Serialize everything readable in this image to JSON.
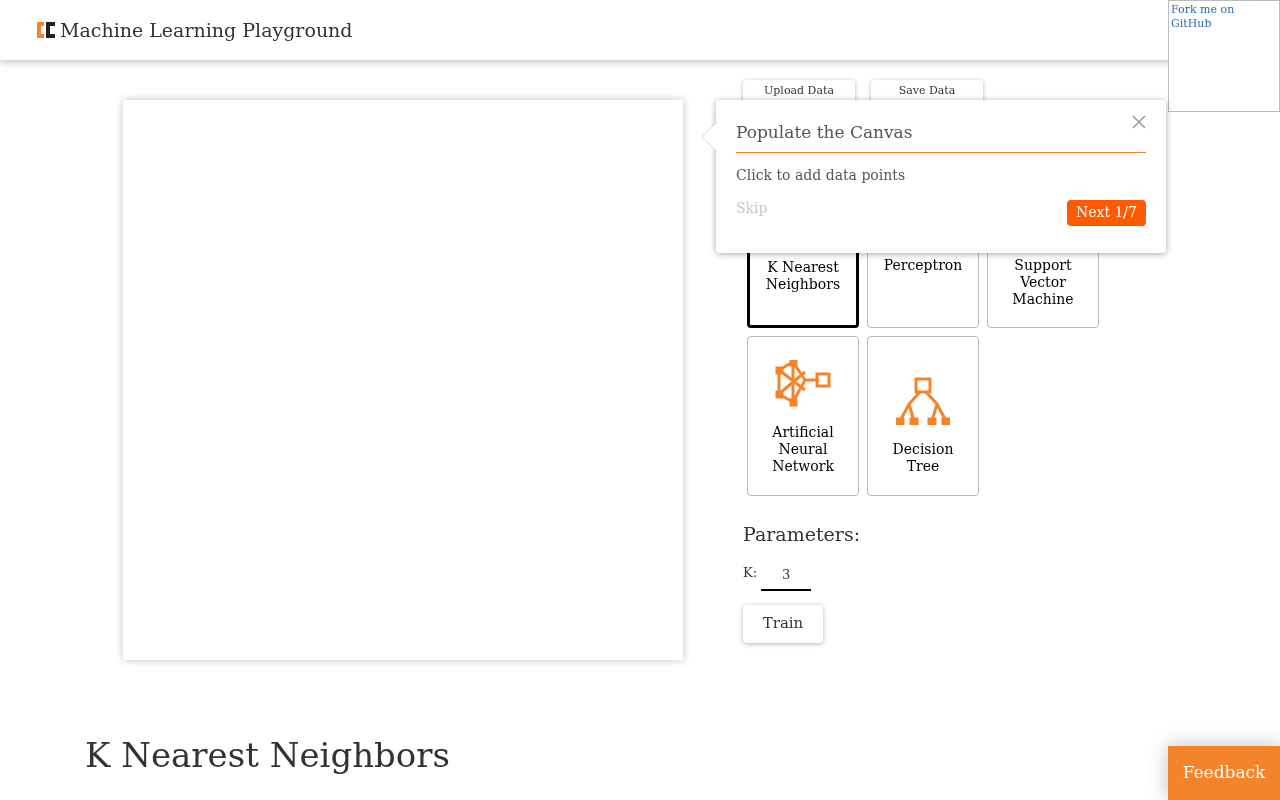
{
  "header": {
    "title": "Machine Learning Playground"
  },
  "fork_link": "Fork me on GitHub",
  "data_buttons": [
    "Upload Data",
    "Save Data"
  ],
  "algorithms": [
    {
      "label": "K Nearest Neighbors",
      "selected": true
    },
    {
      "label": "Perceptron",
      "selected": false
    },
    {
      "label": "Support Vector Machine",
      "selected": false
    },
    {
      "label": "Artificial Neural Network",
      "selected": false,
      "kind": "network"
    },
    {
      "label": "Decision Tree",
      "selected": false,
      "kind": "tree"
    }
  ],
  "parameters": {
    "title": "Parameters:",
    "fields": [
      {
        "label": "K:",
        "value": "3"
      }
    ]
  },
  "train_button": "Train",
  "tour": {
    "title": "Populate the Canvas",
    "body": "Click to add data points",
    "skip": "Skip",
    "next": "Next 1/7"
  },
  "section_title": "K Nearest Neighbors",
  "feedback": "Feedback"
}
